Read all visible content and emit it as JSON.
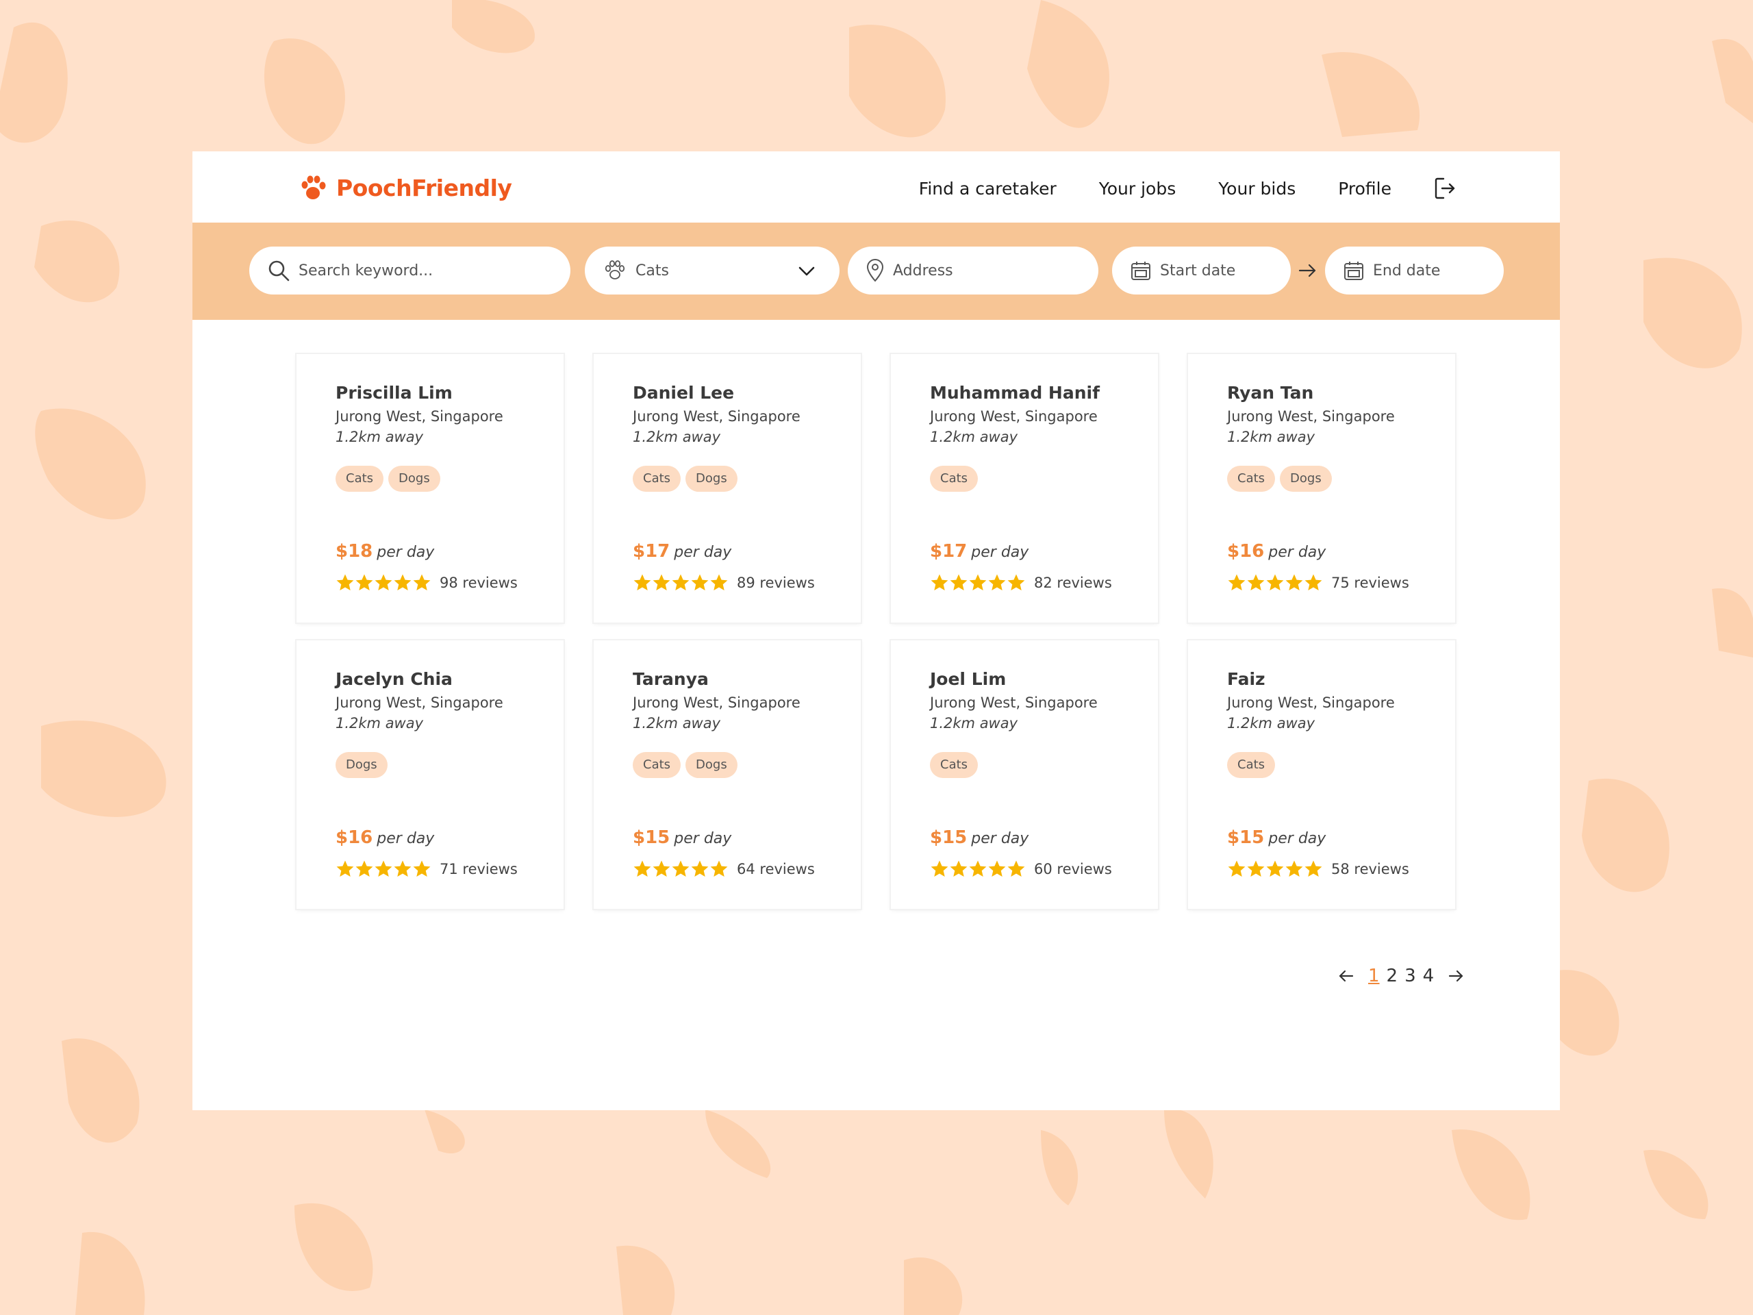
{
  "colors": {
    "brand": "#ef5a1f",
    "accent_price": "#f0883b",
    "searchbar_bg": "#f7c595",
    "tag_bg": "#fddcc3",
    "star": "#f7b500",
    "page_bg": "#ffe1cb"
  },
  "header": {
    "logo_text": "PoochFriendly",
    "logo_icon": "paw-icon",
    "nav": {
      "find_caretaker": "Find a caretaker",
      "your_jobs": "Your jobs",
      "your_bids": "Your bids",
      "profile": "Profile"
    },
    "logout_icon": "logout-icon"
  },
  "search": {
    "keyword_placeholder": "Search keyword...",
    "pet_type_selected": "Cats",
    "address_placeholder": "Address",
    "start_date_placeholder": "Start date",
    "end_date_placeholder": "End date"
  },
  "caretakers": [
    {
      "name": "Priscilla Lim",
      "location": "Jurong West, Singapore",
      "distance": "1.2km away",
      "tags": [
        "Cats",
        "Dogs"
      ],
      "price": "$18",
      "price_unit": "per day",
      "stars": 5,
      "reviews": "98 reviews"
    },
    {
      "name": "Daniel Lee",
      "location": "Jurong West, Singapore",
      "distance": "1.2km away",
      "tags": [
        "Cats",
        "Dogs"
      ],
      "price": "$17",
      "price_unit": "per day",
      "stars": 5,
      "reviews": "89 reviews"
    },
    {
      "name": "Muhammad Hanif",
      "location": "Jurong West, Singapore",
      "distance": "1.2km away",
      "tags": [
        "Cats"
      ],
      "price": "$17",
      "price_unit": "per day",
      "stars": 5,
      "reviews": "82 reviews"
    },
    {
      "name": "Ryan Tan",
      "location": "Jurong West, Singapore",
      "distance": "1.2km away",
      "tags": [
        "Cats",
        "Dogs"
      ],
      "price": "$16",
      "price_unit": "per day",
      "stars": 5,
      "reviews": "75 reviews"
    },
    {
      "name": "Jacelyn Chia",
      "location": "Jurong West, Singapore",
      "distance": "1.2km away",
      "tags": [
        "Dogs"
      ],
      "price": "$16",
      "price_unit": "per day",
      "stars": 5,
      "reviews": "71 reviews"
    },
    {
      "name": "Taranya",
      "location": "Jurong West, Singapore",
      "distance": "1.2km away",
      "tags": [
        "Cats",
        "Dogs"
      ],
      "price": "$15",
      "price_unit": "per day",
      "stars": 5,
      "reviews": "64 reviews"
    },
    {
      "name": "Joel Lim",
      "location": "Jurong West, Singapore",
      "distance": "1.2km away",
      "tags": [
        "Cats"
      ],
      "price": "$15",
      "price_unit": "per day",
      "stars": 5,
      "reviews": "60 reviews"
    },
    {
      "name": "Faiz",
      "location": "Jurong West, Singapore",
      "distance": "1.2km away",
      "tags": [
        "Cats"
      ],
      "price": "$15",
      "price_unit": "per day",
      "stars": 5,
      "reviews": "58 reviews"
    }
  ],
  "pagination": {
    "pages": [
      "1",
      "2",
      "3",
      "4"
    ],
    "current": "1"
  }
}
